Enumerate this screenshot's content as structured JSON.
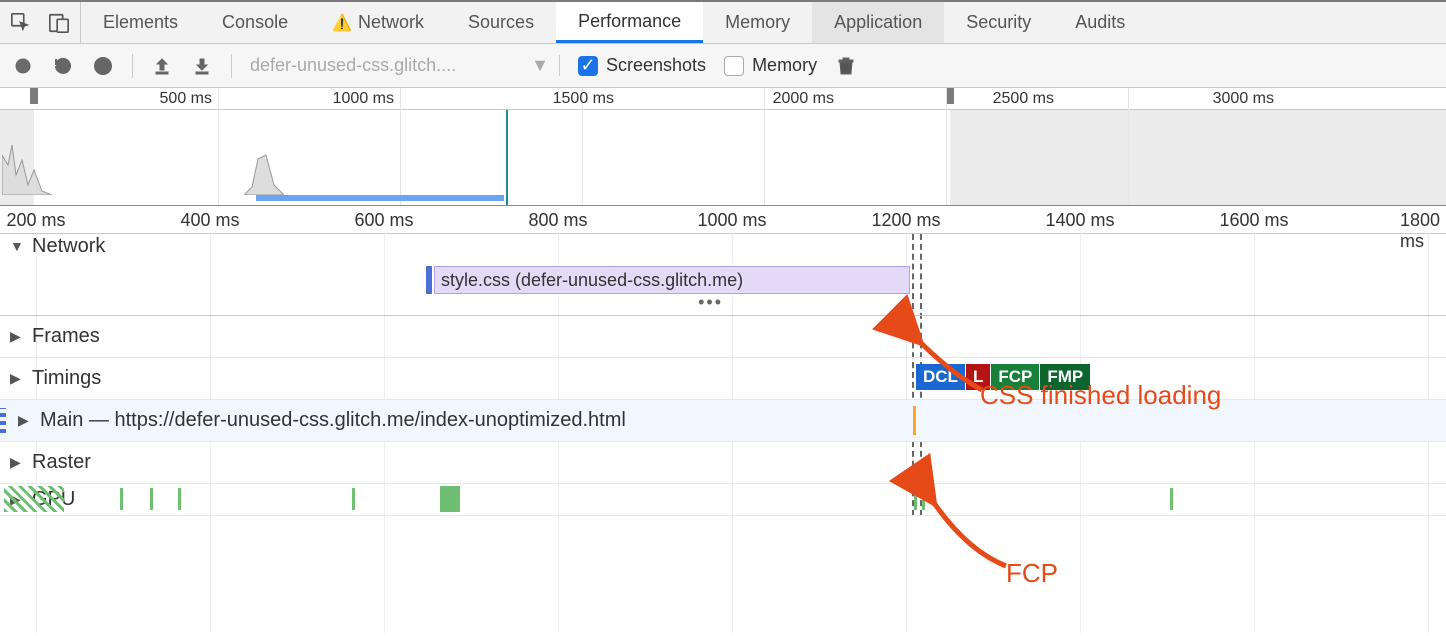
{
  "tabs": {
    "elements": "Elements",
    "console": "Console",
    "network": "Network",
    "sources": "Sources",
    "performance": "Performance",
    "memory": "Memory",
    "application": "Application",
    "security": "Security",
    "audits": "Audits",
    "active": "Performance"
  },
  "toolbar": {
    "url": "defer-unused-css.glitch....",
    "screenshots_label": "Screenshots",
    "screenshots_checked": true,
    "memory_label": "Memory",
    "memory_checked": false
  },
  "overview": {
    "ticks": [
      "500 ms",
      "1000 ms",
      "1500 ms",
      "2000 ms",
      "2500 ms",
      "3000 ms"
    ],
    "right_edge": "35"
  },
  "main_ruler": {
    "ticks": [
      "200 ms",
      "400 ms",
      "600 ms",
      "800 ms",
      "1000 ms",
      "1200 ms",
      "1400 ms",
      "1600 ms",
      "1800 ms"
    ]
  },
  "tracks": {
    "network_label": "Network",
    "network_item": "style.css (defer-unused-css.glitch.me)",
    "frames_label": "Frames",
    "timings_label": "Timings",
    "main_label": "Main — https://defer-unused-css.glitch.me/index-unoptimized.html",
    "raster_label": "Raster",
    "gpu_label": "GPU"
  },
  "timings": {
    "badges": [
      {
        "label": "DCL",
        "color": "#1967d2"
      },
      {
        "label": "L",
        "color": "#b31412"
      },
      {
        "label": "FCP",
        "color": "#188038"
      },
      {
        "label": "FMP",
        "color": "#0d652d"
      }
    ]
  },
  "annotations": {
    "css_finished": "CSS finished loading",
    "fcp": "FCP"
  }
}
